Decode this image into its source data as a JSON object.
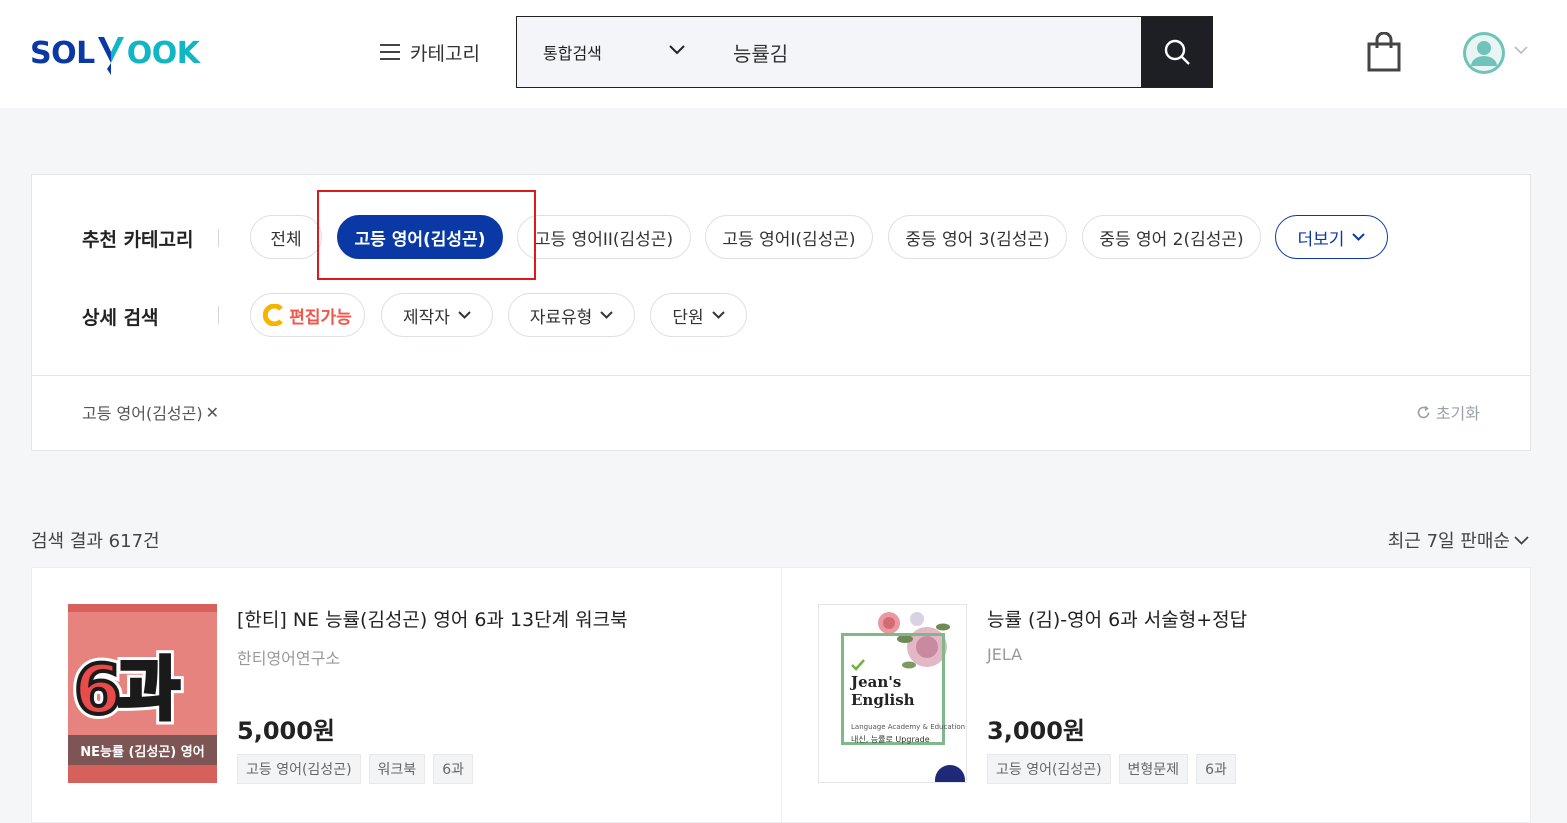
{
  "header": {
    "logo_part1": "SOL",
    "logo_part2": "OOK",
    "category_label": "카테고리",
    "search_scope": "통합검색",
    "search_value": "능률김",
    "icons": [
      "hamburger-icon",
      "chevron-down-icon",
      "search-icon",
      "shopping-bag-icon",
      "user-avatar-icon"
    ]
  },
  "filters": {
    "recommended_label": "추천 카테고리",
    "recommended": [
      "전체",
      "고등 영어(김성곤)",
      "고등 영어II(김성곤)",
      "고등 영어I(김성곤)",
      "중등 영어 3(김성곤)",
      "중등 영어 2(김성곤)"
    ],
    "active_index": 1,
    "more_label": "더보기",
    "detail_label": "상세 검색",
    "editable_label": "편집가능",
    "detail_dropdowns": [
      "제작자",
      "자료유형",
      "단원"
    ],
    "selected_tag": "고등 영어(김성곤)",
    "remove_symbol": "✕",
    "reset_label": "초기화"
  },
  "results": {
    "count_label": "검색 결과 617건",
    "sort_label": "최근 7일 판매순",
    "items": [
      {
        "title": "[한티] NE 능률(김성곤) 영어 6과 13단계 워크북",
        "author": "한티영어연구소",
        "price": "5,000원",
        "tags": [
          "고등 영어(김성곤)",
          "워크북",
          "6과"
        ],
        "thumb_big": "6과",
        "thumb_band": "NE능률 (김성곤) 영어"
      },
      {
        "title": "능률 (김)-영어 6과 서술형+정답",
        "author": "JELA",
        "price": "3,000원",
        "tags": [
          "고등 영어(김성곤)",
          "변형문제",
          "6과"
        ],
        "thumb_title_1": "Jean's",
        "thumb_title_2": "English",
        "thumb_sub": "Language Academy & Education",
        "thumb_line": "내신, 능률로 Upgrade"
      }
    ]
  },
  "colors": {
    "brand_blue": "#0a39a5",
    "brand_teal": "#10b6c4",
    "highlight_red": "#e0191e",
    "search_button": "#1e1f24"
  }
}
